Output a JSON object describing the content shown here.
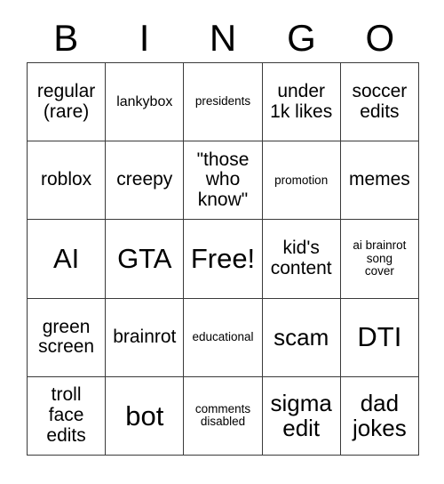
{
  "card": {
    "title": "BINGO",
    "header_letters": [
      "B",
      "I",
      "N",
      "G",
      "O"
    ],
    "free_space_label": "Free!",
    "rows": [
      [
        {
          "text": "regular\n(rare)",
          "size": "md"
        },
        {
          "text": "lankybox",
          "size": "sm"
        },
        {
          "text": "presidents",
          "size": "xs"
        },
        {
          "text": "under\n1k likes",
          "size": "md"
        },
        {
          "text": "soccer\nedits",
          "size": "md"
        }
      ],
      [
        {
          "text": "roblox",
          "size": "md"
        },
        {
          "text": "creepy",
          "size": "md"
        },
        {
          "text": "\"those\nwho\nknow\"",
          "size": "md"
        },
        {
          "text": "promotion",
          "size": "xs"
        },
        {
          "text": "memes",
          "size": "md"
        }
      ],
      [
        {
          "text": "AI",
          "size": "xl"
        },
        {
          "text": "GTA",
          "size": "xl"
        },
        {
          "text": "Free!",
          "size": "xl"
        },
        {
          "text": "kid's\ncontent",
          "size": "md"
        },
        {
          "text": "ai brainrot\nsong\ncover",
          "size": "xs"
        }
      ],
      [
        {
          "text": "green\nscreen",
          "size": "md"
        },
        {
          "text": "brainrot",
          "size": "md"
        },
        {
          "text": "educational",
          "size": "xs"
        },
        {
          "text": "scam",
          "size": "lg"
        },
        {
          "text": "DTI",
          "size": "xl"
        }
      ],
      [
        {
          "text": "troll\nface\nedits",
          "size": "md"
        },
        {
          "text": "bot",
          "size": "xl"
        },
        {
          "text": "comments\ndisabled",
          "size": "xs"
        },
        {
          "text": "sigma\nedit",
          "size": "lg"
        },
        {
          "text": "dad\njokes",
          "size": "lg"
        }
      ]
    ],
    "colors": {
      "background": "#ffffff",
      "text": "#000000",
      "grid_line": "#3a3a3a"
    }
  }
}
